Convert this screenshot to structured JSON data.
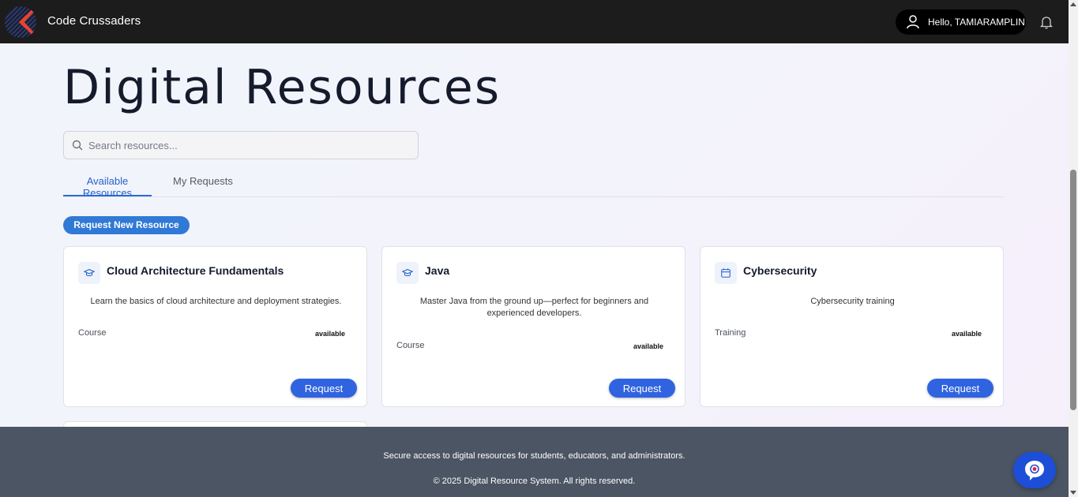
{
  "header": {
    "brand": "Code Crussaders",
    "greeting": "Hello, TAMIARAMPLIN"
  },
  "main": {
    "title": "Digital Resources",
    "search": {
      "placeholder": "Search resources...",
      "value": ""
    },
    "tabs": [
      {
        "label": "Available Resources",
        "active": true
      },
      {
        "label": "My Requests",
        "active": false
      }
    ],
    "request_new_label": "Request New Resource",
    "cards": [
      {
        "title": "Cloud Architecture Fundamentals",
        "icon": "graduation-cap-icon",
        "description": "Learn the basics of cloud architecture and deployment strategies.",
        "type": "Course",
        "status": "available",
        "button": "Request"
      },
      {
        "title": "Java",
        "icon": "graduation-cap-icon",
        "description": "Master Java from the ground up—perfect for beginners and experienced developers.",
        "type": "Course",
        "status": "available",
        "button": "Request"
      },
      {
        "title": "Cybersecurity",
        "icon": "calendar-icon",
        "description": "Cybersecurity training",
        "type": "Training",
        "status": "available",
        "button": "Request"
      }
    ]
  },
  "footer": {
    "tagline": "Secure access to digital resources for students, educators, and administrators.",
    "copyright": "© 2025 Digital Resource System. All rights reserved."
  },
  "colors": {
    "header_bg": "#1c1c1c",
    "accent_blue": "#2f63e0",
    "tab_active": "#2563c9",
    "footer_bg": "#4b5563",
    "logo_red": "#e8432e"
  }
}
